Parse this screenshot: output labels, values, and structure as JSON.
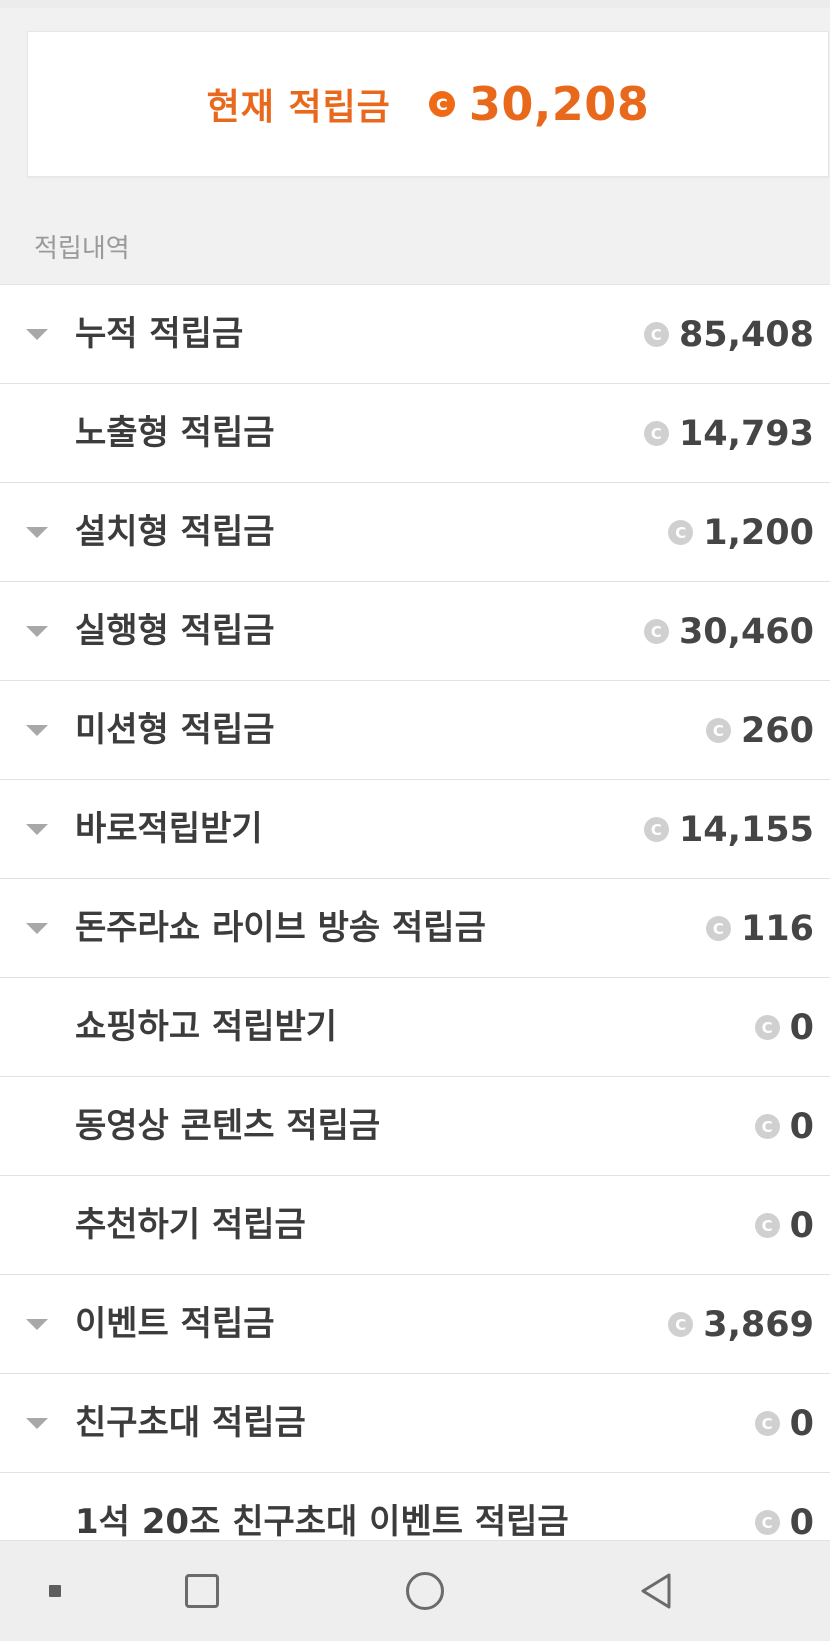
{
  "balance": {
    "label": "현재 적립금",
    "coin_symbol": "C",
    "amount": "30,208",
    "accent_color": "#e8691c"
  },
  "section_title": "적립내역",
  "rows": [
    {
      "label": "누적 적립금",
      "amount": "85,408",
      "expandable": true
    },
    {
      "label": "노출형 적립금",
      "amount": "14,793",
      "expandable": false
    },
    {
      "label": "설치형 적립금",
      "amount": "1,200",
      "expandable": true
    },
    {
      "label": "실행형 적립금",
      "amount": "30,460",
      "expandable": true
    },
    {
      "label": "미션형 적립금",
      "amount": "260",
      "expandable": true
    },
    {
      "label": "바로적립받기",
      "amount": "14,155",
      "expandable": true
    },
    {
      "label": "돈주라쇼 라이브 방송 적립금",
      "amount": "116",
      "expandable": true
    },
    {
      "label": "쇼핑하고 적립받기",
      "amount": "0",
      "expandable": false
    },
    {
      "label": "동영상 콘텐츠 적립금",
      "amount": "0",
      "expandable": false
    },
    {
      "label": "추천하기 적립금",
      "amount": "0",
      "expandable": false
    },
    {
      "label": "이벤트 적립금",
      "amount": "3,869",
      "expandable": true
    },
    {
      "label": "친구초대 적립금",
      "amount": "0",
      "expandable": true
    },
    {
      "label": "1석 20조 친구초대 이벤트 적립금",
      "amount": "0",
      "expandable": false
    }
  ],
  "coin_symbol": "C",
  "nav_bar": {
    "buttons": [
      "dot-icon",
      "recents-icon",
      "home-icon",
      "back-icon"
    ]
  }
}
